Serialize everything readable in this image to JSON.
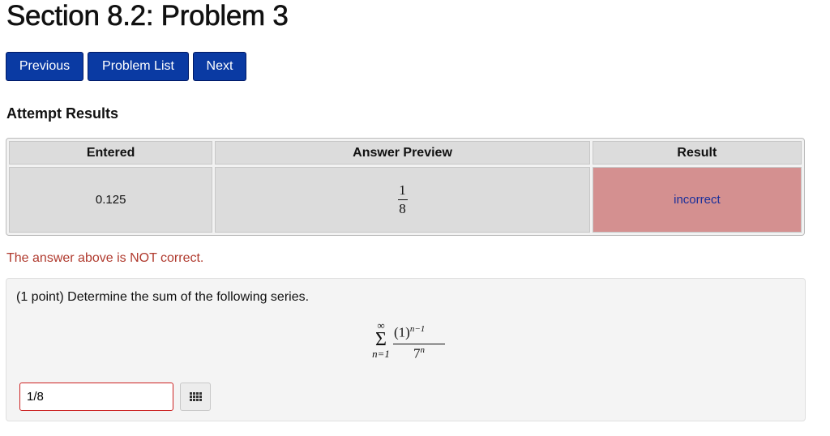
{
  "page": {
    "title": "Section 8.2: Problem 3"
  },
  "nav": {
    "previous": "Previous",
    "problem_list": "Problem List",
    "next": "Next"
  },
  "attempt": {
    "heading": "Attempt Results",
    "headers": [
      "Entered",
      "Answer Preview",
      "Result"
    ],
    "row": {
      "entered": "0.125",
      "preview_numerator": "1",
      "preview_denominator": "8",
      "result": "incorrect"
    },
    "message": "The answer above is NOT correct."
  },
  "problem": {
    "text": "(1 point) Determine the sum of the following series.",
    "series": {
      "upper": "∞",
      "sigma": "Σ",
      "lower": "n=1",
      "numerator_base": "(1)",
      "numerator_exp": "n−1",
      "denominator_base": "7",
      "denominator_exp": "n"
    },
    "answer_value": "1/8"
  },
  "colors": {
    "nav_button": "#0a3aa3",
    "incorrect_cell": "#d49090",
    "error_text": "#b03a2e"
  },
  "icons": {
    "equation_editor": "grid-icon"
  }
}
